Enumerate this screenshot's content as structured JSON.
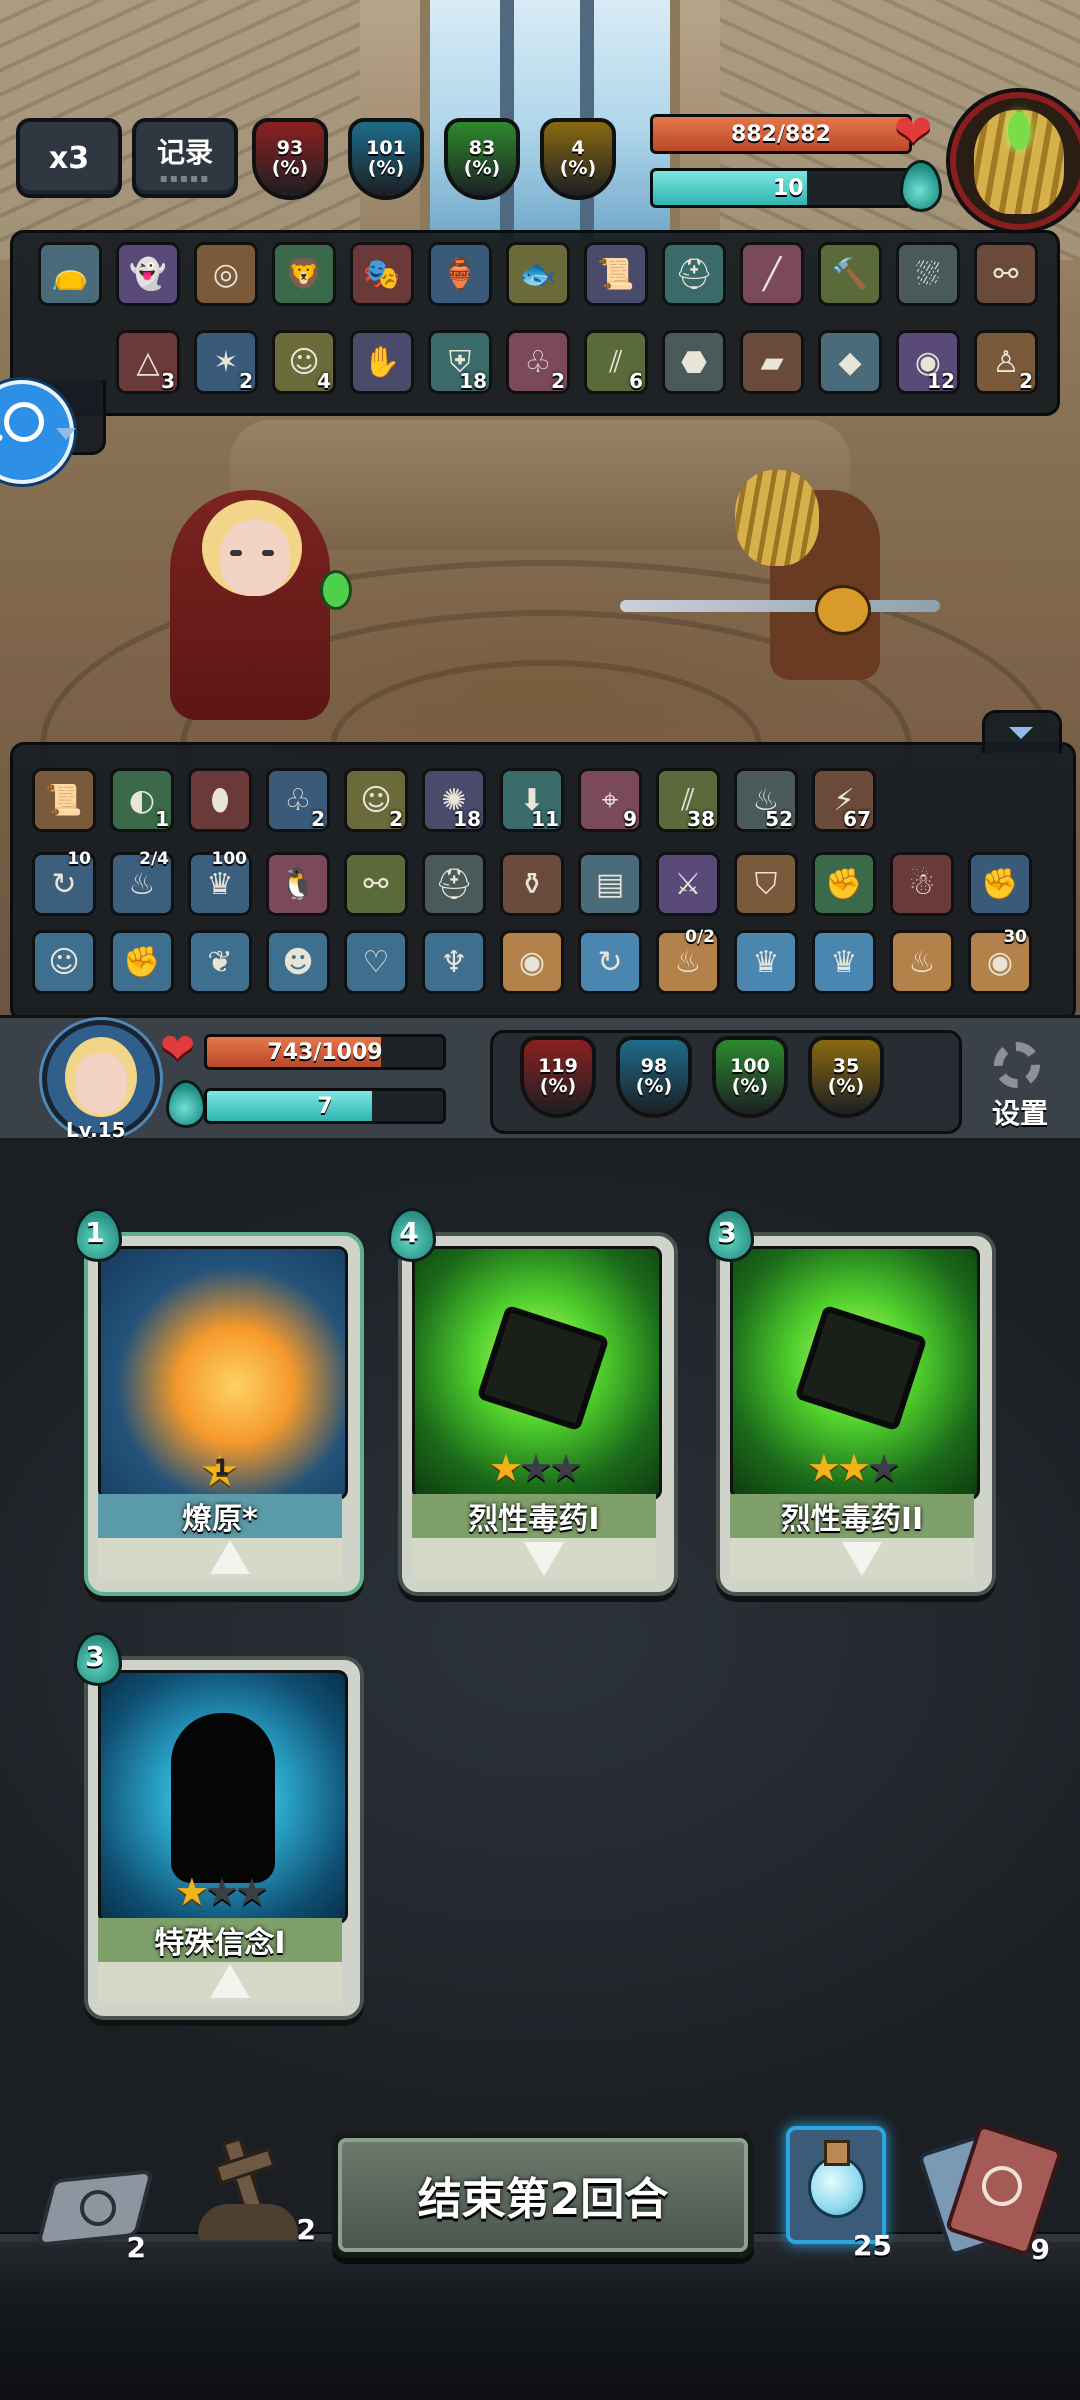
{
  "top_hud": {
    "speed_label": "x3",
    "record_label": "记录",
    "enemy_stats": [
      {
        "value": "93",
        "unit": "(%)",
        "color": "#8c2020",
        "icon": "attack-icon"
      },
      {
        "value": "101",
        "unit": "(%)",
        "color": "#1d6c8a",
        "icon": "question-icon"
      },
      {
        "value": "83",
        "unit": "(%)",
        "color": "#2d8a2d",
        "icon": "defense-icon"
      },
      {
        "value": "4",
        "unit": "(%)",
        "color": "#8a6a10",
        "icon": "crit-icon"
      }
    ],
    "enemy_hp": {
      "text": "882/882",
      "fraction": 1.0
    },
    "enemy_mana": {
      "text": "10",
      "fraction": 0.6
    }
  },
  "enemy_items_row1": [
    "sack-icon",
    "ghost-orb-icon",
    "ring-icon",
    "lion-icon",
    "mask-icon",
    "vase-icon",
    "fish-icon",
    "scroll-icon",
    "helmet-icon",
    "staff-icon",
    "hammer-icon",
    "cloak-icon",
    "goggles-icon"
  ],
  "enemy_buffs_row2": [
    {
      "icon": "triangle-spell-icon",
      "count": "3"
    },
    {
      "icon": "lightning-spell-icon",
      "count": "2"
    },
    {
      "icon": "spirit-face-icon",
      "count": "4"
    },
    {
      "icon": "shadow-hand-icon",
      "count": ""
    },
    {
      "icon": "blue-shield-icon",
      "count": "18"
    },
    {
      "icon": "green-claw-icon",
      "count": "2"
    },
    {
      "icon": "red-slash-icon",
      "count": "6"
    },
    {
      "icon": "poison-stone-icon",
      "count": ""
    },
    {
      "icon": "green-book-icon",
      "count": ""
    },
    {
      "icon": "crystal-icon",
      "count": ""
    },
    {
      "icon": "spiral-icon",
      "count": "12"
    },
    {
      "icon": "strongman-icon",
      "count": "2"
    }
  ],
  "player_buffs_row1": [
    {
      "icon": "scroll-icon",
      "count": ""
    },
    {
      "icon": "dark-swirl-icon",
      "count": "1"
    },
    {
      "icon": "green-egg-icon",
      "count": ""
    },
    {
      "icon": "green-claw-icon",
      "count": "2"
    },
    {
      "icon": "spirit-face-icon",
      "count": "2"
    },
    {
      "icon": "purple-swirl-icon",
      "count": "18"
    },
    {
      "icon": "down-arrow-icon",
      "count": "11"
    },
    {
      "icon": "target-icon",
      "count": "9"
    },
    {
      "icon": "red-slash-icon",
      "count": "38"
    },
    {
      "icon": "red-spiral-icon",
      "count": "52"
    },
    {
      "icon": "lightning-icon",
      "count": "67"
    }
  ],
  "player_items_row2": [
    {
      "icon": "cycle-rune-icon",
      "top": "10"
    },
    {
      "icon": "fire-rune-icon",
      "top": "2/4"
    },
    {
      "icon": "crown-rune-icon",
      "top": "100"
    },
    {
      "icon": "penguin-icon",
      "top": ""
    },
    {
      "icon": "goggles-icon",
      "top": ""
    },
    {
      "icon": "knight-helm-icon",
      "top": ""
    },
    {
      "icon": "potion-bag-icon",
      "top": ""
    },
    {
      "icon": "map-icon",
      "top": ""
    },
    {
      "icon": "sword-icon",
      "top": ""
    },
    {
      "icon": "shield-icon",
      "top": ""
    },
    {
      "icon": "red-glove-icon",
      "top": ""
    },
    {
      "icon": "ghost-doll-icon",
      "top": ""
    },
    {
      "icon": "gauntlet-icon",
      "top": ""
    }
  ],
  "player_runes_row3": [
    {
      "icon": "rune-face-icon",
      "top": ""
    },
    {
      "icon": "rune-fist-icon",
      "top": ""
    },
    {
      "icon": "rune-leaf-icon",
      "top": ""
    },
    {
      "icon": "rune-mask-icon",
      "top": ""
    },
    {
      "icon": "rune-heart-icon",
      "top": ""
    },
    {
      "icon": "rune-bowl-icon",
      "top": ""
    },
    {
      "icon": "eye-rune-icon",
      "top": ""
    },
    {
      "icon": "cycle-rune-icon",
      "top": ""
    },
    {
      "icon": "fire-rune-icon",
      "top": "0/2"
    },
    {
      "icon": "crown-rune-icon",
      "top": ""
    },
    {
      "icon": "crown-rune-icon",
      "top": ""
    },
    {
      "icon": "fire-rune-icon",
      "top": ""
    },
    {
      "icon": "eye-rune-icon",
      "top": "30"
    }
  ],
  "player_hud": {
    "level": "Lv.15",
    "hp": {
      "text": "743/1009",
      "fraction": 0.736
    },
    "mana": {
      "text": "7",
      "fraction": 0.7
    },
    "stats": [
      {
        "value": "119",
        "unit": "(%)",
        "color": "#8c2020"
      },
      {
        "value": "98",
        "unit": "(%)",
        "color": "#1d6c8a"
      },
      {
        "value": "100",
        "unit": "(%)",
        "color": "#2d8a2d"
      },
      {
        "value": "35",
        "unit": "(%)",
        "color": "#8a6a10"
      }
    ],
    "settings_label": "设置"
  },
  "cards": [
    {
      "cost": "1",
      "name": "燎原*",
      "level": "1",
      "stars_on": 0,
      "stars_total": 0,
      "art": "phoenix-fire",
      "arrow": "up",
      "name_bg": "#5b9aa8"
    },
    {
      "cost": "4",
      "name": "烈性毒药I",
      "level": "",
      "stars_on": 1,
      "stars_total": 3,
      "art": "poison",
      "arrow": "down",
      "name_bg": "#7fa06a"
    },
    {
      "cost": "3",
      "name": "烈性毒药II",
      "level": "",
      "stars_on": 2,
      "stars_total": 3,
      "art": "poison",
      "arrow": "down",
      "name_bg": "#7fa06a"
    },
    {
      "cost": "3",
      "name": "特殊信念I",
      "level": "",
      "stars_on": 1,
      "stars_total": 3,
      "art": "silhouette",
      "arrow": "up",
      "name_bg": "#7fa06a"
    }
  ],
  "bottom_bar": {
    "draw_pile": "2",
    "grave_count": "2",
    "end_turn_label": "结束第2回合",
    "potion_count": "25",
    "discard_count": "9"
  }
}
